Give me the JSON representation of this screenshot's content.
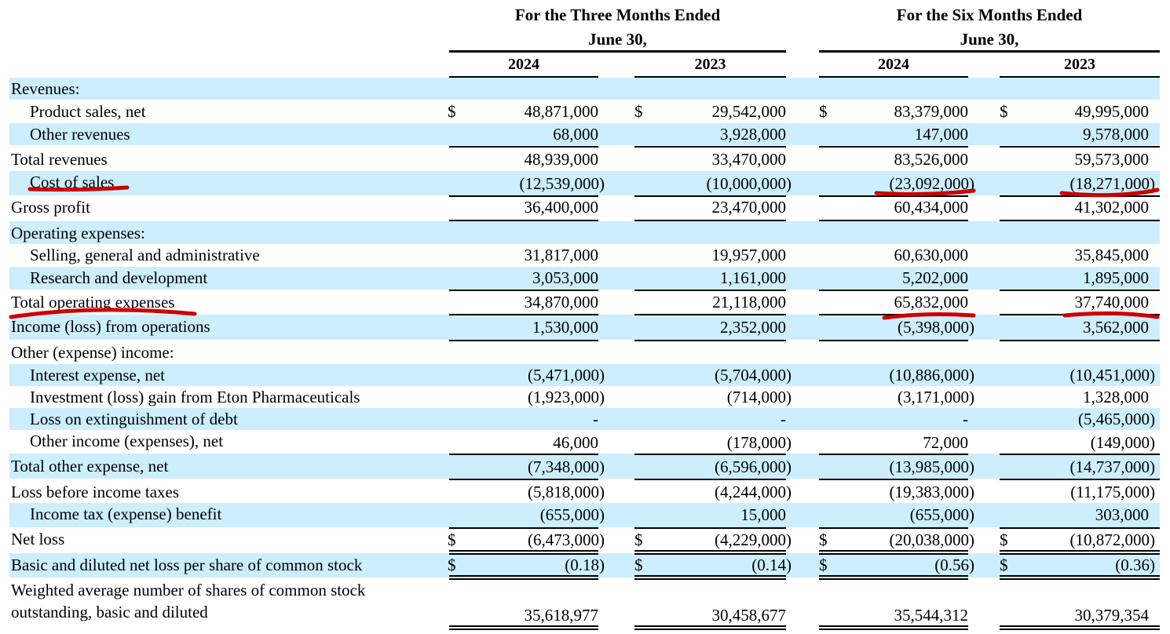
{
  "header": {
    "three_months_line1": "For the Three Months Ended",
    "three_months_line2": "June 30,",
    "six_months_line1": "For the Six Months Ended",
    "six_months_line2": "June 30,",
    "years": [
      "2024",
      "2023",
      "2024",
      "2023"
    ]
  },
  "currency_symbol": "$",
  "rows": [
    {
      "label": "Revenues:",
      "indent": false,
      "values": [
        "",
        "",
        "",
        ""
      ],
      "dollar": false
    },
    {
      "label": "Product sales, net",
      "indent": true,
      "values": [
        "48,871,000",
        "29,542,000",
        "83,379,000",
        "49,995,000"
      ],
      "dollar": true
    },
    {
      "label": "Other revenues",
      "indent": true,
      "values": [
        "68,000",
        "3,928,000",
        "147,000",
        "9,578,000"
      ],
      "dollar": false
    },
    {
      "label": "Total revenues",
      "indent": false,
      "values": [
        "48,939,000",
        "33,470,000",
        "83,526,000",
        "59,573,000"
      ],
      "dollar": false
    },
    {
      "label": "Cost of sales",
      "indent": true,
      "values": [
        "(12,539,000)",
        "(10,000,000)",
        "(23,092,000)",
        "(18,271,000)"
      ],
      "dollar": false
    },
    {
      "label": "Gross profit",
      "indent": false,
      "values": [
        "36,400,000",
        "23,470,000",
        "60,434,000",
        "41,302,000"
      ],
      "dollar": false
    },
    {
      "label": "Operating expenses:",
      "indent": false,
      "values": [
        "",
        "",
        "",
        ""
      ],
      "dollar": false
    },
    {
      "label": "Selling, general and administrative",
      "indent": true,
      "values": [
        "31,817,000",
        "19,957,000",
        "60,630,000",
        "35,845,000"
      ],
      "dollar": false
    },
    {
      "label": "Research and development",
      "indent": true,
      "values": [
        "3,053,000",
        "1,161,000",
        "5,202,000",
        "1,895,000"
      ],
      "dollar": false
    },
    {
      "label": "Total operating expenses",
      "indent": false,
      "values": [
        "34,870,000",
        "21,118,000",
        "65,832,000",
        "37,740,000"
      ],
      "dollar": false
    },
    {
      "label": "Income (loss) from operations",
      "indent": false,
      "values": [
        "1,530,000",
        "2,352,000",
        "(5,398,000)",
        "3,562,000"
      ],
      "dollar": false
    },
    {
      "label": "Other (expense) income:",
      "indent": false,
      "values": [
        "",
        "",
        "",
        ""
      ],
      "dollar": false
    },
    {
      "label": "Interest expense, net",
      "indent": true,
      "values": [
        "(5,471,000)",
        "(5,704,000)",
        "(10,886,000)",
        "(10,451,000)"
      ],
      "dollar": false
    },
    {
      "label": "Investment (loss) gain from Eton Pharmaceuticals",
      "indent": true,
      "values": [
        "(1,923,000)",
        "(714,000)",
        "(3,171,000)",
        "1,328,000"
      ],
      "dollar": false
    },
    {
      "label": "Loss on extinguishment of debt",
      "indent": true,
      "values": [
        "-",
        "-",
        "-",
        "(5,465,000)"
      ],
      "dollar": false
    },
    {
      "label": "Other income (expenses), net",
      "indent": true,
      "values": [
        "46,000",
        "(178,000)",
        "72,000",
        "(149,000)"
      ],
      "dollar": false
    },
    {
      "label": "Total other expense, net",
      "indent": false,
      "values": [
        "(7,348,000)",
        "(6,596,000)",
        "(13,985,000)",
        "(14,737,000)"
      ],
      "dollar": false
    },
    {
      "label": "Loss before income taxes",
      "indent": false,
      "values": [
        "(5,818,000)",
        "(4,244,000)",
        "(19,383,000)",
        "(11,175,000)"
      ],
      "dollar": false
    },
    {
      "label": "Income tax (expense) benefit",
      "indent": true,
      "values": [
        "(655,000)",
        "15,000",
        "(655,000)",
        "303,000"
      ],
      "dollar": false
    },
    {
      "label": "Net loss",
      "indent": false,
      "values": [
        "(6,473,000)",
        "(4,229,000)",
        "(20,038,000)",
        "(10,872,000)"
      ],
      "dollar": true
    },
    {
      "label": "Basic and diluted net loss per share of common stock",
      "indent": false,
      "values": [
        "(0.18)",
        "(0.14)",
        "(0.56)",
        "(0.36)"
      ],
      "dollar": true
    },
    {
      "label": "Weighted average number of shares of common stock",
      "label2": "outstanding, basic and diluted",
      "indent": false,
      "values": [
        "35,618,977",
        "30,458,677",
        "35,544,312",
        "30,379,354"
      ],
      "dollar": false
    }
  ],
  "annotation_color": "#cc0000"
}
